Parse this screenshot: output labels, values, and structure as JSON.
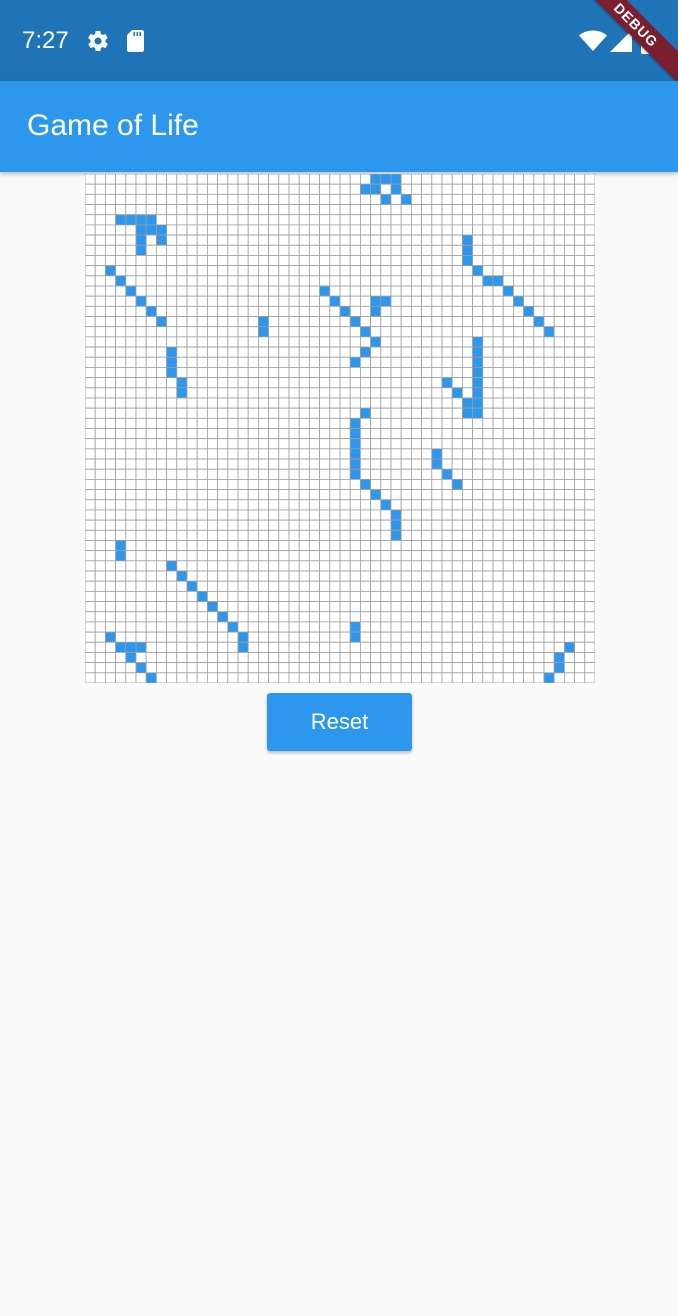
{
  "status_bar": {
    "time": "7:27",
    "icons": [
      "gear-icon",
      "sd-card-icon",
      "wifi-icon",
      "signal-icon",
      "battery-icon"
    ]
  },
  "debug_banner": "DEBUG",
  "app_bar": {
    "title": "Game of Life"
  },
  "grid": {
    "columns": 50,
    "rows": 50,
    "alive_color": "#2d97ee",
    "dead_color": "#ffffff",
    "line_color": "#9e9e9e",
    "alive_cells": [
      [
        0,
        28
      ],
      [
        0,
        29
      ],
      [
        0,
        30
      ],
      [
        1,
        27
      ],
      [
        1,
        28
      ],
      [
        1,
        30
      ],
      [
        2,
        29
      ],
      [
        2,
        31
      ],
      [
        4,
        3
      ],
      [
        4,
        4
      ],
      [
        4,
        5
      ],
      [
        4,
        6
      ],
      [
        5,
        5
      ],
      [
        5,
        6
      ],
      [
        5,
        7
      ],
      [
        6,
        5
      ],
      [
        6,
        7
      ],
      [
        7,
        5
      ],
      [
        9,
        2
      ],
      [
        10,
        3
      ],
      [
        11,
        4
      ],
      [
        12,
        5
      ],
      [
        13,
        6
      ],
      [
        14,
        7
      ],
      [
        17,
        8
      ],
      [
        18,
        8
      ],
      [
        19,
        8
      ],
      [
        11,
        23
      ],
      [
        12,
        24
      ],
      [
        13,
        25
      ],
      [
        14,
        26
      ],
      [
        15,
        27
      ],
      [
        16,
        28
      ],
      [
        17,
        27
      ],
      [
        18,
        26
      ],
      [
        12,
        28
      ],
      [
        12,
        29
      ],
      [
        13,
        28
      ],
      [
        6,
        37
      ],
      [
        7,
        37
      ],
      [
        8,
        37
      ],
      [
        9,
        38
      ],
      [
        10,
        39
      ],
      [
        16,
        38
      ],
      [
        17,
        38
      ],
      [
        18,
        38
      ],
      [
        19,
        38
      ],
      [
        20,
        38
      ],
      [
        21,
        38
      ],
      [
        22,
        38
      ],
      [
        23,
        38
      ],
      [
        23,
        37
      ],
      [
        22,
        37
      ],
      [
        21,
        36
      ],
      [
        20,
        35
      ],
      [
        10,
        40
      ],
      [
        11,
        41
      ],
      [
        12,
        42
      ],
      [
        13,
        43
      ],
      [
        14,
        44
      ],
      [
        15,
        45
      ],
      [
        23,
        27
      ],
      [
        24,
        26
      ],
      [
        25,
        26
      ],
      [
        26,
        26
      ],
      [
        27,
        26
      ],
      [
        28,
        26
      ],
      [
        29,
        26
      ],
      [
        30,
        27
      ],
      [
        31,
        28
      ],
      [
        32,
        29
      ],
      [
        33,
        30
      ],
      [
        34,
        30
      ],
      [
        35,
        30
      ],
      [
        27,
        34
      ],
      [
        28,
        34
      ],
      [
        29,
        35
      ],
      [
        30,
        36
      ],
      [
        38,
        8
      ],
      [
        39,
        9
      ],
      [
        40,
        10
      ],
      [
        41,
        11
      ],
      [
        42,
        12
      ],
      [
        43,
        13
      ],
      [
        44,
        14
      ],
      [
        45,
        15
      ],
      [
        46,
        15
      ],
      [
        45,
        2
      ],
      [
        46,
        3
      ],
      [
        47,
        4
      ],
      [
        48,
        5
      ],
      [
        49,
        6
      ],
      [
        49,
        45
      ],
      [
        48,
        46
      ],
      [
        47,
        46
      ],
      [
        46,
        47
      ],
      [
        47,
        4
      ],
      [
        46,
        4
      ],
      [
        46,
        5
      ],
      [
        14,
        17
      ],
      [
        15,
        17
      ],
      [
        20,
        9
      ],
      [
        21,
        9
      ],
      [
        36,
        3
      ],
      [
        37,
        3
      ],
      [
        44,
        26
      ],
      [
        45,
        26
      ]
    ]
  }
}
